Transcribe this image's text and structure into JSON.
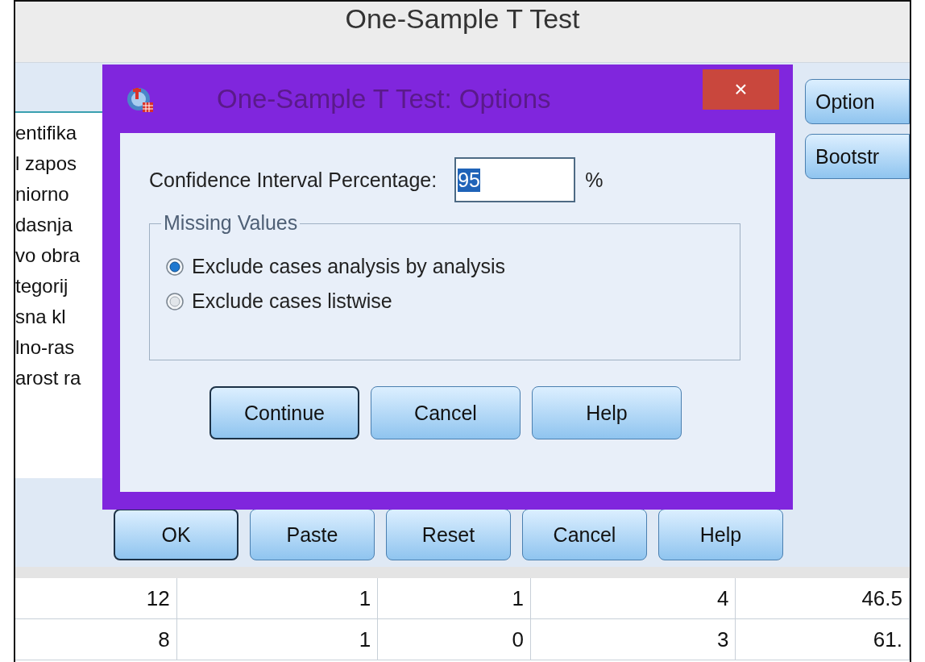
{
  "parent_window": {
    "title": "One-Sample T Test",
    "variable_list": [
      "entifika",
      "l zapos",
      "niorno",
      "dasnja",
      "vo obra",
      "tegorij",
      "sna kl",
      "lno-ras",
      "arost ra"
    ],
    "side_buttons": [
      "Option",
      "Bootstr"
    ],
    "buttons": [
      {
        "label": "OK",
        "default": true
      },
      {
        "label": "Paste",
        "default": false
      },
      {
        "label": "Reset",
        "default": false
      },
      {
        "label": "Cancel",
        "default": false
      },
      {
        "label": "Help",
        "default": false
      }
    ]
  },
  "data_grid": {
    "rows": [
      [
        "12",
        "1",
        "1",
        "4",
        "46.5"
      ],
      [
        "8",
        "1",
        "0",
        "3",
        "61."
      ]
    ]
  },
  "dialog": {
    "title": "One-Sample T Test: Options",
    "close": "×",
    "confidence_label": "Confidence Interval Percentage:",
    "confidence_value": "95",
    "value_selected": true,
    "unit": "%",
    "group_title": "Missing Values",
    "options": [
      {
        "label": "Exclude cases analysis by analysis",
        "selected": true
      },
      {
        "label": "Exclude cases listwise",
        "selected": false
      }
    ],
    "buttons": [
      {
        "label": "Continue",
        "default": true
      },
      {
        "label": "Cancel",
        "default": false
      },
      {
        "label": "Help",
        "default": false
      }
    ]
  }
}
